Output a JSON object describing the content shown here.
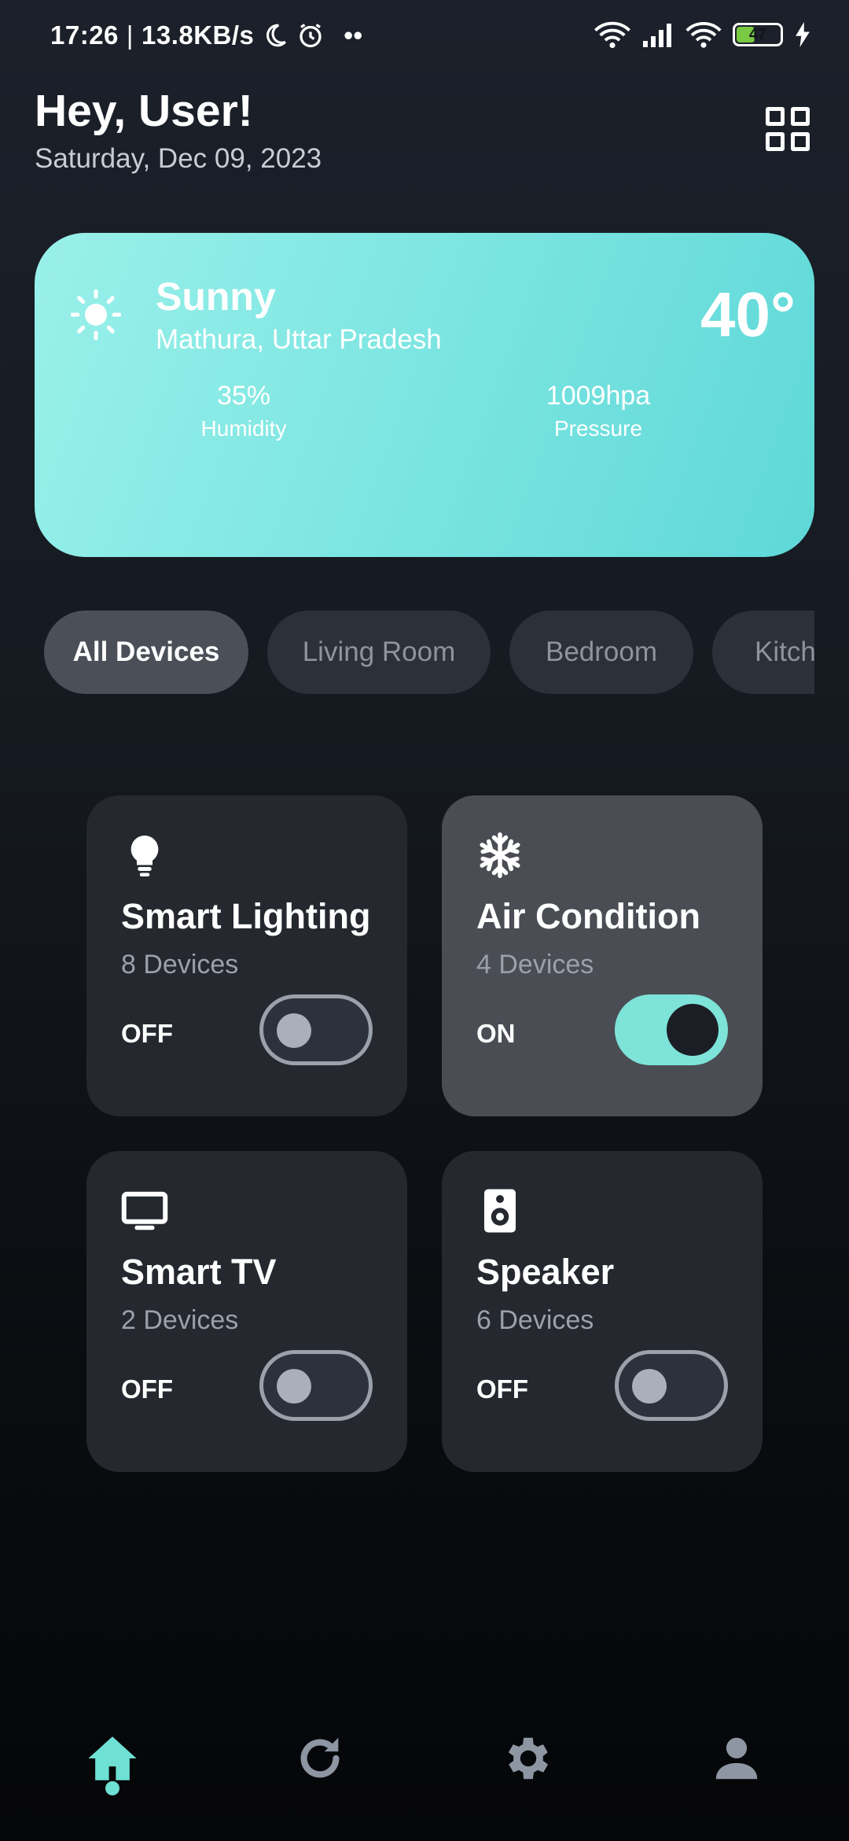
{
  "status_bar": {
    "time": "17:26",
    "separator": "|",
    "net_speed": "13.8KB/s",
    "dots": "••",
    "battery": "47"
  },
  "header": {
    "greeting": "Hey, User!",
    "date": "Saturday, Dec 09, 2023",
    "grid_icon": "grid-icon"
  },
  "weather": {
    "icon": "sun-icon",
    "condition": "Sunny",
    "location": "Mathura, Uttar Pradesh",
    "temperature": "40°",
    "humidity_value": "35%",
    "humidity_label": "Humidity",
    "pressure_value": "1009hpa",
    "pressure_label": "Pressure",
    "gradient": [
      "#9af0ea",
      "#5ed8d8"
    ]
  },
  "tabs": [
    {
      "label": "All Devices",
      "active": true
    },
    {
      "label": "Living Room",
      "active": false
    },
    {
      "label": "Bedroom",
      "active": false
    },
    {
      "label": "Kitchen",
      "active": false
    }
  ],
  "devices": [
    {
      "name": "Smart Lighting",
      "count": "8 Devices",
      "state": "OFF",
      "on": false,
      "icon": "bulb-icon"
    },
    {
      "name": "Air Condition",
      "count": "4 Devices",
      "state": "ON",
      "on": true,
      "icon": "snowflake-icon"
    },
    {
      "name": "Smart TV",
      "count": "2 Devices",
      "state": "OFF",
      "on": false,
      "icon": "tv-icon"
    },
    {
      "name": "Speaker",
      "count": "6 Devices",
      "state": "OFF",
      "on": false,
      "icon": "speaker-icon"
    }
  ],
  "nav": [
    {
      "icon": "home-icon",
      "active": true
    },
    {
      "icon": "refresh-icon",
      "active": false
    },
    {
      "icon": "gear-icon",
      "active": false
    },
    {
      "icon": "person-icon",
      "active": false
    }
  ],
  "colors": {
    "accent": "#6ee0d4",
    "toggle_on": "#7ee3d8",
    "nav_inactive": "#8e96a3",
    "battery": "#7ac943"
  }
}
